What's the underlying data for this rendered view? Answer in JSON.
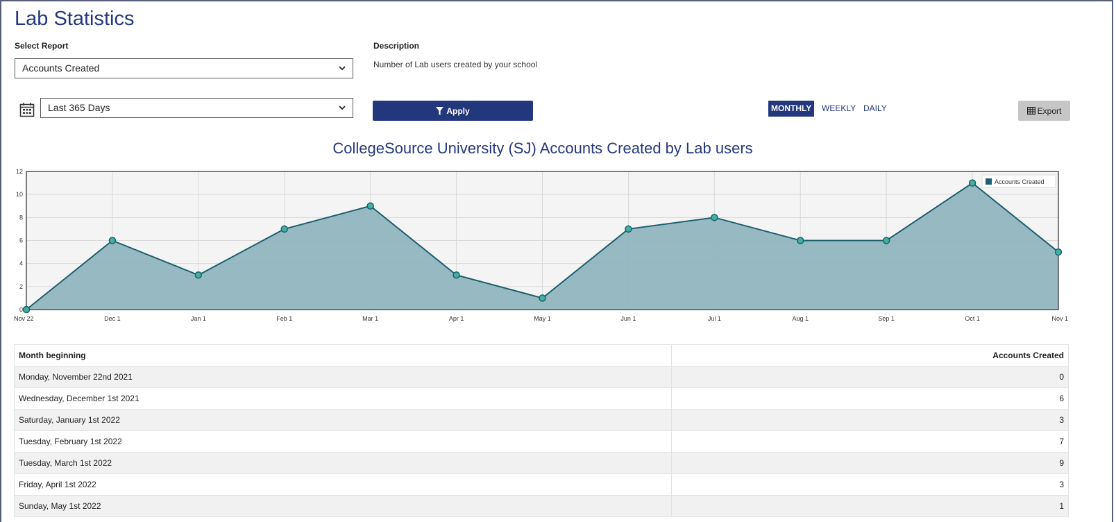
{
  "page": {
    "title": "Lab Statistics"
  },
  "report": {
    "label": "Select Report",
    "selected": "Accounts Created",
    "description_label": "Description",
    "description": "Number of Lab users created by your school"
  },
  "range": {
    "selected": "Last 365 Days"
  },
  "apply": {
    "label": "Apply"
  },
  "periods": {
    "monthly": "MONTHLY",
    "weekly": "WEEKLY",
    "daily": "DAILY",
    "active": "monthly"
  },
  "export": {
    "label": "Export"
  },
  "colors": {
    "brand": "#23377d",
    "series_line": "#1d5f6e",
    "series_fill": "#8db4bd",
    "marker_fill": "#3fb1a0",
    "plot_bg": "#f4f4f4"
  },
  "chart_data": {
    "type": "area",
    "title": "CollegeSource University (SJ) Accounts Created by Lab users",
    "categories": [
      "Nov 22",
      "Dec 1",
      "Jan 1",
      "Feb 1",
      "Mar 1",
      "Apr 1",
      "May 1",
      "Jun 1",
      "Jul 1",
      "Aug 1",
      "Sep 1",
      "Oct 1",
      "Nov 1"
    ],
    "series": [
      {
        "name": "Accounts Created",
        "values": [
          0,
          6,
          3,
          7,
          9,
          3,
          1,
          7,
          8,
          6,
          6,
          11,
          5
        ]
      }
    ],
    "ylim": [
      0,
      12
    ],
    "yticks": [
      0,
      2,
      4,
      6,
      8,
      10,
      12
    ],
    "grid": true,
    "legend_position": "top-right"
  },
  "table": {
    "headers": {
      "month": "Month beginning",
      "count": "Accounts Created"
    },
    "rows": [
      {
        "month": "Monday, November 22nd 2021",
        "count": "0"
      },
      {
        "month": "Wednesday, December 1st 2021",
        "count": "6"
      },
      {
        "month": "Saturday, January 1st 2022",
        "count": "3"
      },
      {
        "month": "Tuesday, February 1st 2022",
        "count": "7"
      },
      {
        "month": "Tuesday, March 1st 2022",
        "count": "9"
      },
      {
        "month": "Friday, April 1st 2022",
        "count": "3"
      },
      {
        "month": "Sunday, May 1st 2022",
        "count": "1"
      }
    ]
  }
}
